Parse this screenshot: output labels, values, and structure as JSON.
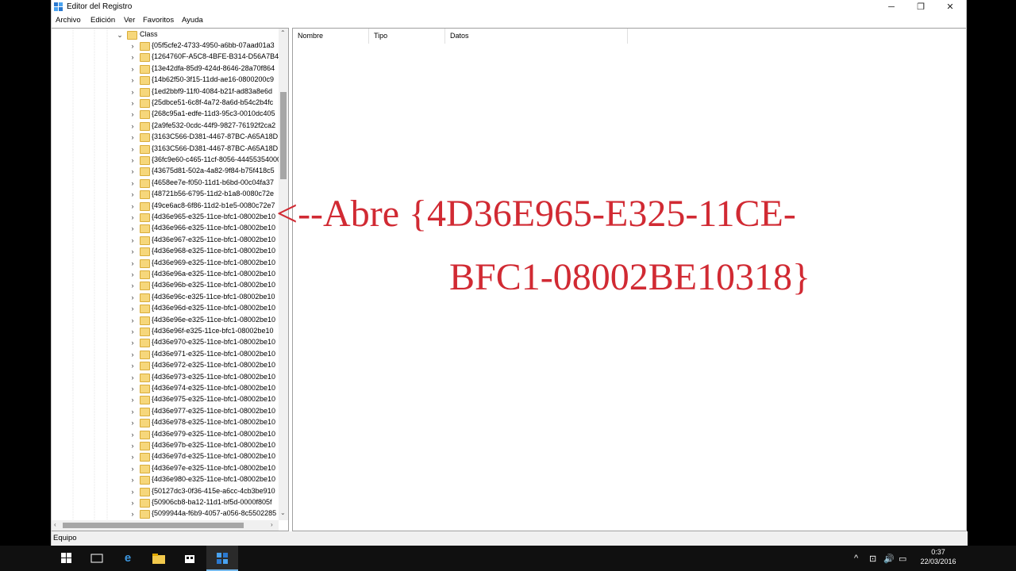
{
  "window": {
    "title": "Editor del Registro",
    "controls": {
      "minimize": "─",
      "restore": "❐",
      "close": "✕"
    }
  },
  "menu": [
    "Archivo",
    "Edición",
    "Ver",
    "Favoritos",
    "Ayuda"
  ],
  "tree": {
    "class_label": "Class",
    "items": [
      "{05f5cfe2-4733-4950-a6bb-07aad01a3",
      "{1264760F-A5C8-4BFE-B314-D56A7B4",
      "{13e42dfa-85d9-424d-8646-28a70f864",
      "{14b62f50-3f15-11dd-ae16-0800200c9",
      "{1ed2bbf9-11f0-4084-b21f-ad83a8e6d",
      "{25dbce51-6c8f-4a72-8a6d-b54c2b4fc",
      "{268c95a1-edfe-11d3-95c3-0010dc405",
      "{2a9fe532-0cdc-44f9-9827-76192f2ca2",
      "{3163C566-D381-4467-87BC-A65A18D",
      "{3163C566-D381-4467-87BC-A65A18D",
      "{36fc9e60-c465-11cf-8056-44455354000",
      "{43675d81-502a-4a82-9f84-b75f418c5",
      "{4658ee7e-f050-11d1-b6bd-00c04fa37",
      "{48721b56-6795-11d2-b1a8-0080c72e",
      "{49ce6ac8-6f86-11d2-b1e5-0080c72e7",
      "{4d36e965-e325-11ce-bfc1-08002be10",
      "{4d36e966-e325-11ce-bfc1-08002be10",
      "{4d36e967-e325-11ce-bfc1-08002be10",
      "{4d36e968-e325-11ce-bfc1-08002be10",
      "{4d36e969-e325-11ce-bfc1-08002be10",
      "{4d36e96a-e325-11ce-bfc1-08002be10",
      "{4d36e96b-e325-11ce-bfc1-08002be10",
      "{4d36e96c-e325-11ce-bfc1-08002be10",
      "{4d36e96d-e325-11ce-bfc1-08002be10",
      "{4d36e96e-e325-11ce-bfc1-08002be10",
      "{4d36e96f-e325-11ce-bfc1-08002be10",
      "{4d36e970-e325-11ce-bfc1-08002be10",
      "{4d36e971-e325-11ce-bfc1-08002be10",
      "{4d36e972-e325-11ce-bfc1-08002be10",
      "{4d36e973-e325-11ce-bfc1-08002be10",
      "{4d36e974-e325-11ce-bfc1-08002be10",
      "{4d36e975-e325-11ce-bfc1-08002be10",
      "{4d36e977-e325-11ce-bfc1-08002be10",
      "{4d36e978-e325-11ce-bfc1-08002be10",
      "{4d36e979-e325-11ce-bfc1-08002be10",
      "{4d36e97b-e325-11ce-bfc1-08002be10",
      "{4d36e97d-e325-11ce-bfc1-08002be10",
      "{4d36e97e-e325-11ce-bfc1-08002be10",
      "{4d36e980-e325-11ce-bfc1-08002be10",
      "{50127dc3-0f36-415e-a6cc-4cb3be910",
      "{50906cb8-ba12-11d1-bf5d-0000f805f",
      "{5099944a-f6b9-4057-a056-8c5502285"
    ]
  },
  "list": {
    "columns": [
      "Nombre",
      "Tipo",
      "Datos"
    ]
  },
  "annotation": {
    "line1": "<--Abre {4D36E965-E325-11CE-",
    "line2": "BFC1-08002BE10318}"
  },
  "statusbar": {
    "path": "Equipo"
  },
  "taskbar": {
    "icons": [
      "windows-start-icon",
      "task-view-icon",
      "edge-icon",
      "file-explorer-icon",
      "store-icon",
      "regedit-icon"
    ],
    "tray": [
      "^",
      "⊡",
      "🔊",
      "▭"
    ],
    "time": "0:37",
    "date": "22/03/2016"
  },
  "colors": {
    "annotation": "#d12a33",
    "folder": "#f6d77b",
    "taskbar": "#101010"
  }
}
